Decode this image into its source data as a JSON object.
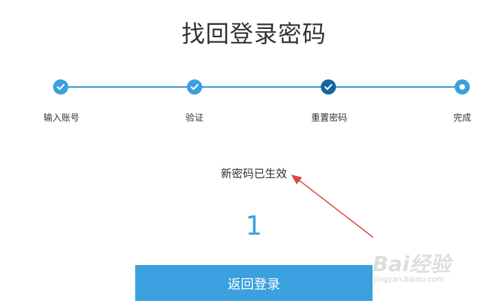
{
  "page": {
    "title": "找回登录密码"
  },
  "steps": [
    {
      "label": "输入账号",
      "state": "done"
    },
    {
      "label": "验证",
      "state": "done"
    },
    {
      "label": "重置密码",
      "state": "current"
    },
    {
      "label": "完成",
      "state": "final"
    }
  ],
  "result": {
    "status_text": "新密码已生效",
    "countdown": "1"
  },
  "actions": {
    "back_label": "返回登录"
  },
  "watermark": {
    "logo": "Bai经验",
    "url": "jingyan.baidu.com"
  },
  "colors": {
    "accent": "#3aa0dc",
    "current_step": "#17669f",
    "button": "#3aa0e0",
    "annotation_arrow": "#d9473f"
  },
  "icons": {
    "done": "check-icon",
    "final": "dot-icon"
  }
}
